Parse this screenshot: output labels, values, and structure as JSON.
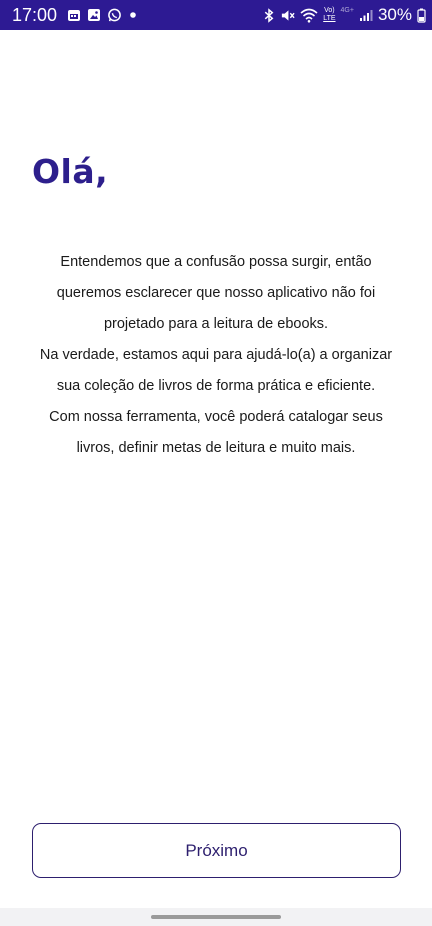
{
  "status_bar": {
    "time": "17:00",
    "battery": "30%",
    "network_top": "Vo)",
    "network_bottom": "LTE",
    "network_gen": "4G+",
    "left_icons": [
      "calendar-icon",
      "gallery-icon",
      "whatsapp-icon",
      "dot-icon"
    ],
    "right_icons": [
      "bluetooth-icon",
      "mute-icon",
      "wifi-icon",
      "volte-icon",
      "signal-icon",
      "battery-icon"
    ]
  },
  "onboarding": {
    "greeting": "Olá,",
    "paragraphs": [
      "Entendemos que a confusão possa surgir, então queremos esclarecer que nosso aplicativo não foi projetado para a leitura de ebooks.",
      "Na verdade, estamos aqui para ajudá-lo(a) a organizar sua coleção de livros de forma prática e eficiente.",
      "Com nossa ferramenta, você poderá catalogar seus livros, definir metas de leitura e muito mais."
    ],
    "next_label": "Próximo"
  },
  "colors": {
    "status_bar": "#2d1a93",
    "greeting": "#2d1f8c",
    "button_border": "#2d1f6e",
    "nav_bar": "#f2f2f4"
  }
}
